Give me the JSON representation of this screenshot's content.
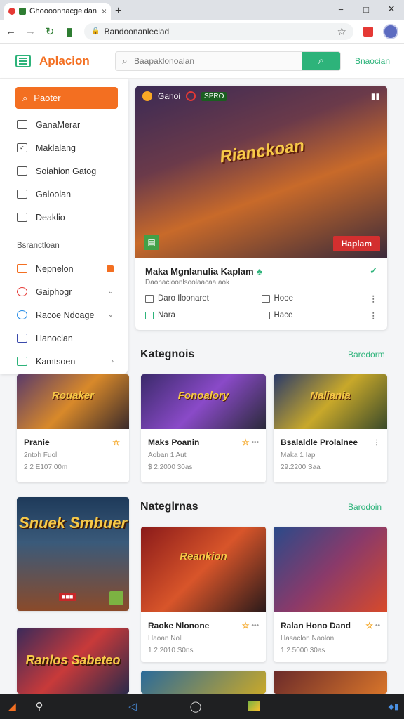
{
  "browser": {
    "tab_title": "Ghoooonnacgeldan",
    "tab_close": "×",
    "new_tab": "+",
    "url": "Bandoonanleclad"
  },
  "header": {
    "brand": "Aplacion",
    "search_placeholder": "Baapaklonoalan",
    "link": "Bnaocian"
  },
  "sidebar": {
    "primary": "Paoter",
    "items": [
      {
        "label": "GanaMerar"
      },
      {
        "label": "Maklalang"
      },
      {
        "label": "Soiahion Gatog"
      },
      {
        "label": "Galoolan"
      },
      {
        "label": "Deaklio"
      }
    ],
    "section": "Bsranctloan",
    "sub_items": [
      {
        "label": "Nepnelon"
      },
      {
        "label": "Gaiphogr"
      },
      {
        "label": "Racoe Ndoage"
      },
      {
        "label": "Hanoclan"
      },
      {
        "label": "Kamtsoen"
      }
    ]
  },
  "hero": {
    "top_label": "Ganoi",
    "badge": "SPRO",
    "title_art": "Rianckoan",
    "cta": "Haplam",
    "name": "Maka Mgnlanulia Kaplam",
    "sub": "Daonacloonlsoolaacaa aok",
    "meta": [
      {
        "label": "Daro Iloonaret"
      },
      {
        "label": "Hooe"
      },
      {
        "label": "Nara"
      },
      {
        "label": "Hace"
      }
    ]
  },
  "sections": {
    "first": {
      "title": "Kategnois",
      "link": "Baredorm"
    },
    "second": {
      "title": "Nateglrnas",
      "link": "Barodoin"
    }
  },
  "cards_row1": [
    {
      "art": "Rouaker",
      "name": "Pranie",
      "meta": "2ntoh Fuol",
      "time": "2 2 E107:00m"
    },
    {
      "art": "Fonoalory",
      "name": "Maks Poanin",
      "meta": "Aoban 1 Aut",
      "time": "$ 2.2000 30as"
    },
    {
      "art": "Naliania",
      "name": "Bsalaldle Prolalnee",
      "meta": "Maka 1 Iap",
      "time": "29.2200 Saa"
    }
  ],
  "tall_card": {
    "art": "Snuek Smbuer"
  },
  "cards_row2": [
    {
      "art": "Reankion",
      "name": "Raoke Nlonone",
      "meta": "Haoan Noll",
      "time": "1 2.2010 S0ns"
    },
    {
      "art": "",
      "name": "Ralan Hono Dand",
      "meta": "Hasaclon Naolon",
      "time": "1 2.5000 30as"
    }
  ],
  "bottom_tile": {
    "art": "Ranlos Sabeteo"
  },
  "colors": {
    "accent": "#f36f21",
    "brand_green": "#2db37a"
  }
}
